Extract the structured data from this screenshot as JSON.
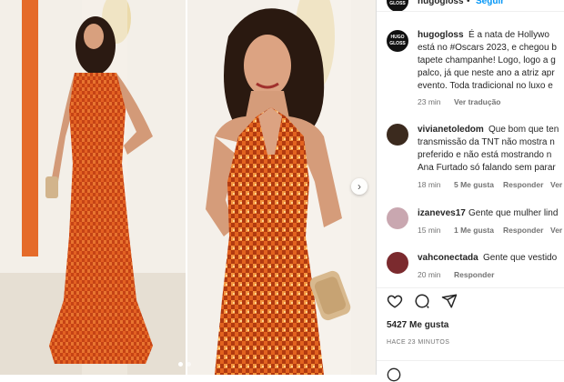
{
  "post": {
    "author": "hugogloss",
    "follow_label": "Seguir",
    "avatar_text": [
      "HUGO",
      "GLOSS"
    ],
    "caption_lines": [
      "É a nata de Hollywo",
      "está no #Oscars 2023, e chegou b",
      "tapete champanhe! Logo, logo a g",
      "palco, já que neste ano a atriz apr",
      "evento. Toda tradicional no luxo e"
    ],
    "caption_time": "23 min",
    "translate_label": "Ver tradução"
  },
  "comments": [
    {
      "user": "vivianetoledom",
      "lines": [
        "Que bom que ten",
        "transmissão da TNT não mostra n",
        "preferido e não está mostrando n",
        "Ana Furtado só falando sem parar"
      ],
      "time": "18 min",
      "likes": "5 Me gusta",
      "reply": "Responder",
      "more": "Ver"
    },
    {
      "user": "izaneves17",
      "lines": [
        "Gente que mulher lind"
      ],
      "time": "15 min",
      "likes": "1 Me gusta",
      "reply": "Responder",
      "more": "Ver"
    },
    {
      "user": "vahconectada",
      "lines": [
        "Gente que vestido"
      ],
      "time": "20 min",
      "reply": "Responder"
    }
  ],
  "actions": {
    "likes_count": "5427 Me gusta",
    "timestamp": "HACE 23 MINUTOS"
  },
  "colors": {
    "dress": "#d9531e",
    "link": "#00376b",
    "meta": "#737373",
    "follow": "#0095f6"
  }
}
